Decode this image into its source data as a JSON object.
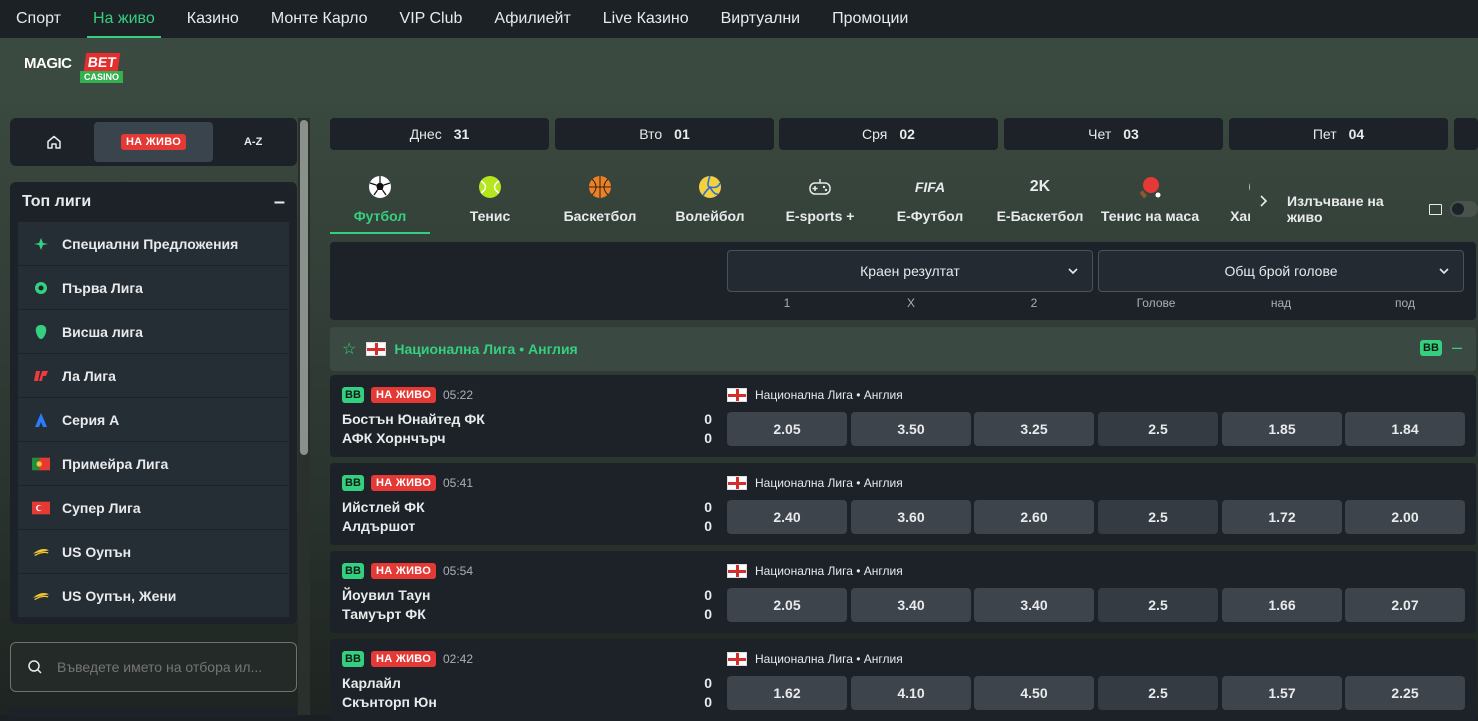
{
  "topnav": [
    "Спорт",
    "На живо",
    "Казино",
    "Монте Карло",
    "VIP Club",
    "Афилиейт",
    "Live Казино",
    "Виртуални",
    "Промоции"
  ],
  "active_nav": "На живо",
  "logo": {
    "magic": "MAGIC",
    "bet": "BET",
    "casino": "CASINO"
  },
  "sidebar": {
    "live_label": "НА ЖИВО",
    "az_label": "A-Z",
    "top_leagues_title": "Топ лиги",
    "leagues": [
      {
        "label": "Специални Предложения",
        "icon": "special-offers-icon"
      },
      {
        "label": "Първа Лига",
        "icon": "premier-league-icon"
      },
      {
        "label": "Висша лига",
        "icon": "premier-league-lion-icon"
      },
      {
        "label": "Ла Лига",
        "icon": "la-liga-icon"
      },
      {
        "label": "Серия А",
        "icon": "serie-a-icon"
      },
      {
        "label": "Примейра Лига",
        "icon": "portugal-flag-icon"
      },
      {
        "label": "Супер Лига",
        "icon": "turkey-flag-icon"
      },
      {
        "label": "US Оупън",
        "icon": "us-open-icon"
      },
      {
        "label": "US Оупън, Жени",
        "icon": "us-open-icon"
      }
    ],
    "search_placeholder": "Въведете името на отбора ил..."
  },
  "days": [
    {
      "day": "Днес",
      "num": "31"
    },
    {
      "day": "Вто",
      "num": "01"
    },
    {
      "day": "Сря",
      "num": "02"
    },
    {
      "day": "Чет",
      "num": "03"
    },
    {
      "day": "Пет",
      "num": "04"
    }
  ],
  "sports": [
    {
      "label": "Футбол",
      "icon": "football-icon"
    },
    {
      "label": "Тенис",
      "icon": "tennis-icon"
    },
    {
      "label": "Баскетбол",
      "icon": "basketball-icon"
    },
    {
      "label": "Волейбол",
      "icon": "volleyball-icon"
    },
    {
      "label": "E-sports +",
      "icon": "gamepad-icon"
    },
    {
      "label": "E-Футбол",
      "icon": "fifa-icon",
      "icon_text": "FIFA"
    },
    {
      "label": "E-Баскетбол",
      "icon": "2k-icon",
      "icon_text": "2K"
    },
    {
      "label": "Тенис на маса",
      "icon": "table-tennis-icon"
    },
    {
      "label": "Хандбал",
      "icon": "handball-icon"
    }
  ],
  "stream_label": "Излъчване на живо",
  "markets": {
    "select1": "Краен резултат",
    "select2": "Общ брой голове",
    "cols": [
      "1",
      "X",
      "2",
      "Голове",
      "над",
      "под"
    ]
  },
  "league_header": "Национална Лига • Англия",
  "bb": "BB",
  "live_badge": "НА ЖИВО",
  "events": [
    {
      "time": "05:22",
      "home": "Бостън Юнайтед ФК",
      "away": "АФК Хорнчърч",
      "home_score": "0",
      "away_score": "0",
      "league": "Национална Лига • Англия",
      "odds": [
        "2.05",
        "3.50",
        "3.25",
        "2.5",
        "1.85",
        "1.84"
      ]
    },
    {
      "time": "05:41",
      "home": "Ийстлей ФК",
      "away": "Алдършот",
      "home_score": "0",
      "away_score": "0",
      "league": "Национална Лига • Англия",
      "odds": [
        "2.40",
        "3.60",
        "2.60",
        "2.5",
        "1.72",
        "2.00"
      ]
    },
    {
      "time": "05:54",
      "home": "Йоувил Таун",
      "away": "Тамуърт ФК",
      "home_score": "0",
      "away_score": "0",
      "league": "Национална Лига • Англия",
      "odds": [
        "2.05",
        "3.40",
        "3.40",
        "2.5",
        "1.66",
        "2.07"
      ]
    },
    {
      "time": "02:42",
      "home": "Карлайл",
      "away": "Скънторп Юн",
      "home_score": "0",
      "away_score": "0",
      "league": "Национална Лига • Англия",
      "odds": [
        "1.62",
        "4.10",
        "4.50",
        "2.5",
        "1.57",
        "2.25"
      ]
    }
  ],
  "colors": {
    "accent": "#35d07f",
    "live": "#e53935",
    "panel": "#1c2228",
    "odd_bg": "#3d444b"
  }
}
